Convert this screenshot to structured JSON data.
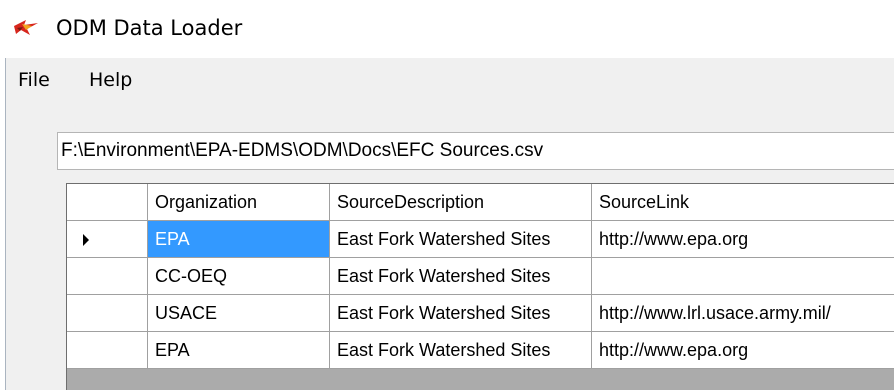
{
  "window": {
    "title": "ODM Data Loader",
    "icon": "odm-app-icon"
  },
  "menu": {
    "items": [
      {
        "label": "File"
      },
      {
        "label": "Help"
      }
    ]
  },
  "file_path": {
    "value": "F:\\Environment\\EPA-EDMS\\ODM\\Docs\\EFC Sources.csv"
  },
  "grid": {
    "columns": [
      "Organization",
      "SourceDescription",
      "SourceLink"
    ],
    "rows": [
      {
        "current": true,
        "organization": "EPA",
        "source_description": "East Fork Watershed Sites",
        "source_link": "http://www.epa.org"
      },
      {
        "current": false,
        "organization": "CC-OEQ",
        "source_description": "East Fork Watershed Sites",
        "source_link": ""
      },
      {
        "current": false,
        "organization": "USACE",
        "source_description": "East Fork Watershed Sites",
        "source_link": "http://www.lrl.usace.army.mil/"
      },
      {
        "current": false,
        "organization": "EPA",
        "source_description": "East Fork Watershed Sites",
        "source_link": "http://www.epa.org"
      }
    ],
    "selection_color": "#3399ff"
  }
}
